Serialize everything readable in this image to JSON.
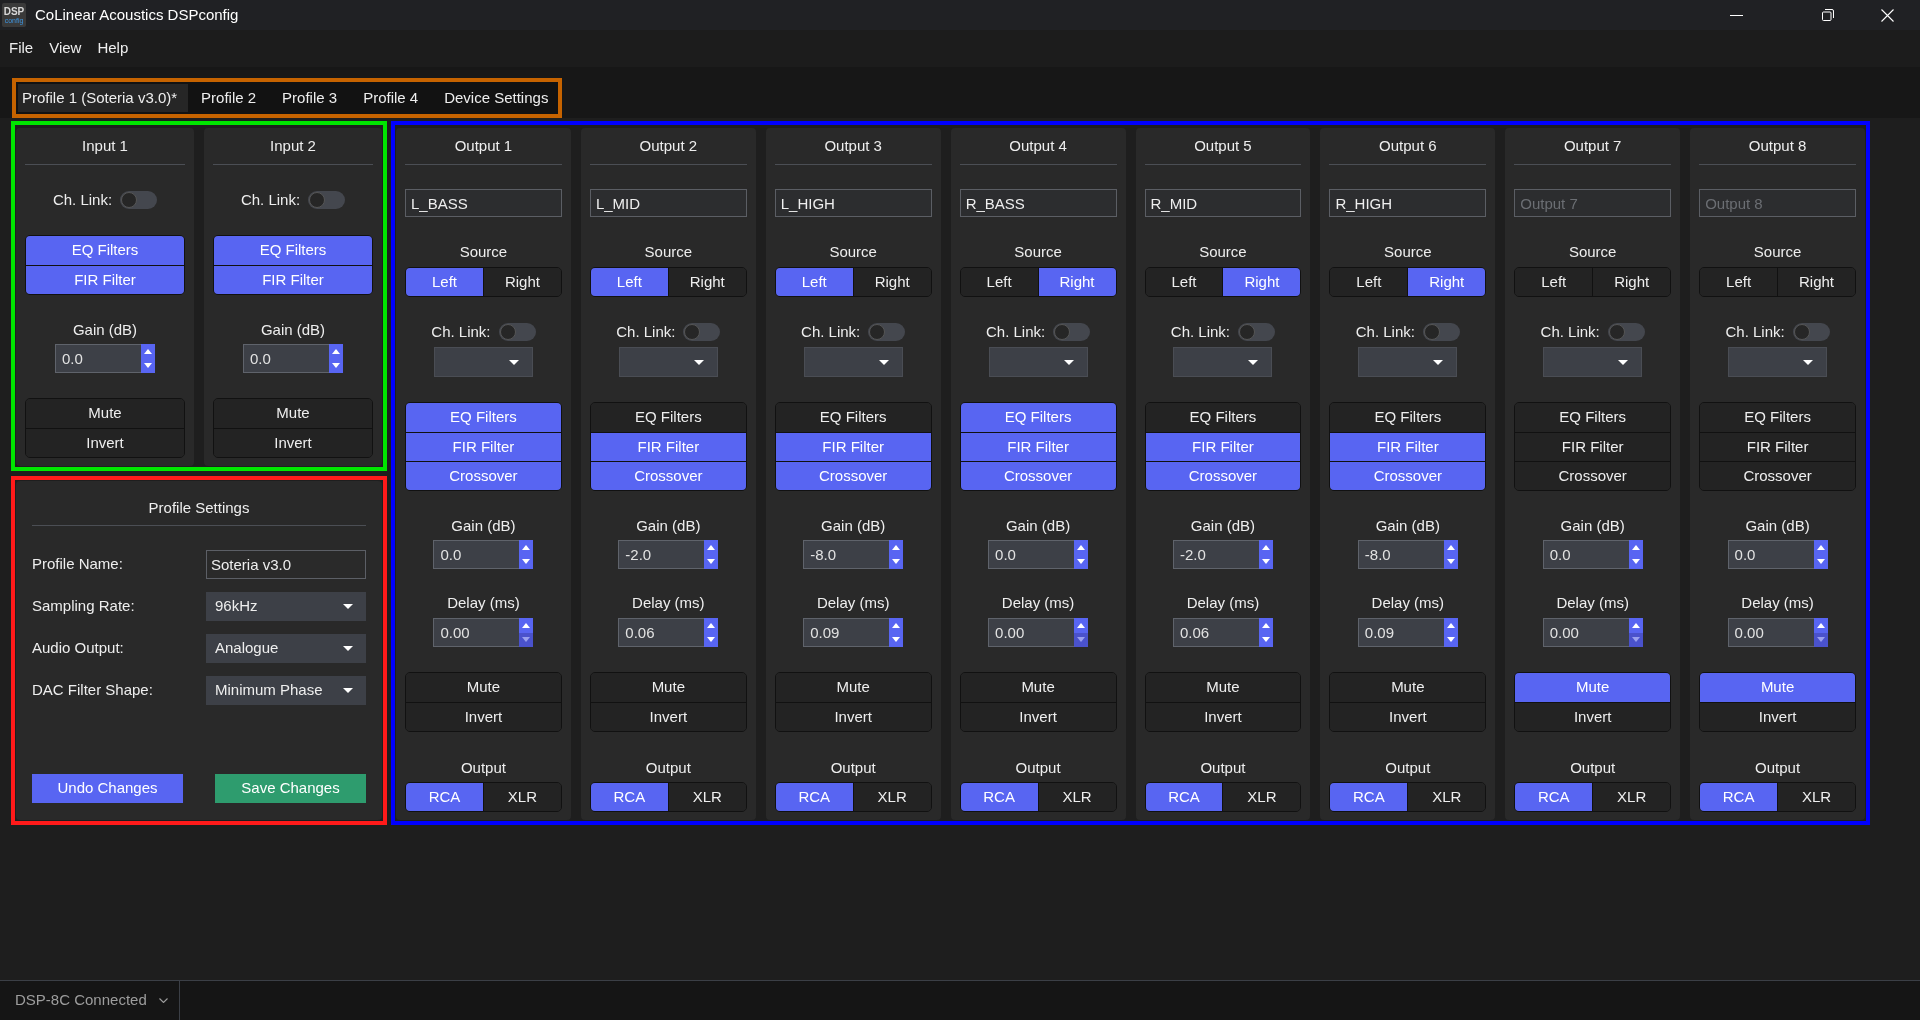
{
  "window": {
    "title": "CoLinear Acoustics DSPconfig",
    "logo_text": [
      "DSP",
      "config"
    ]
  },
  "menu": [
    "File",
    "View",
    "Help"
  ],
  "tabs": [
    {
      "label": "Profile 1 (Soteria v3.0)*",
      "selected": true
    },
    {
      "label": "Profile 2",
      "selected": false
    },
    {
      "label": "Profile 3",
      "selected": false
    },
    {
      "label": "Profile 4",
      "selected": false
    },
    {
      "label": "Device Settings",
      "selected": false
    }
  ],
  "inputs": [
    {
      "title": "Input 1",
      "ch_link": {
        "label": "Ch. Link:",
        "on": false
      },
      "processing": [
        {
          "label": "EQ Filters",
          "on": true
        },
        {
          "label": "FIR Filter",
          "on": true
        }
      ],
      "gain": {
        "label": "Gain (dB)",
        "value": "0.0"
      },
      "toggles": [
        {
          "label": "Mute",
          "on": false
        },
        {
          "label": "Invert",
          "on": false
        }
      ]
    },
    {
      "title": "Input 2",
      "ch_link": {
        "label": "Ch. Link:",
        "on": false
      },
      "processing": [
        {
          "label": "EQ Filters",
          "on": true
        },
        {
          "label": "FIR Filter",
          "on": true
        }
      ],
      "gain": {
        "label": "Gain (dB)",
        "value": "0.0"
      },
      "toggles": [
        {
          "label": "Mute",
          "on": false
        },
        {
          "label": "Invert",
          "on": false
        }
      ]
    }
  ],
  "profile_settings": {
    "title": "Profile Settings",
    "fields": [
      {
        "label": "Profile Name:",
        "kind": "text",
        "value": "Soteria v3.0"
      },
      {
        "label": "Sampling Rate:",
        "kind": "dropdown",
        "value": "96kHz"
      },
      {
        "label": "Audio Output:",
        "kind": "dropdown",
        "value": "Analogue"
      },
      {
        "label": "DAC Filter Shape:",
        "kind": "dropdown",
        "value": "Minimum Phase"
      }
    ],
    "buttons": [
      {
        "label": "Undo Changes",
        "kind": "undo"
      },
      {
        "label": "Save Changes",
        "kind": "save"
      }
    ]
  },
  "outputs": [
    {
      "title": "Output 1",
      "name": {
        "value": "L_BASS"
      },
      "source": {
        "label": "Source",
        "options": [
          {
            "label": "Left",
            "selected": true
          },
          {
            "label": "Right",
            "selected": false
          }
        ]
      },
      "ch_link": {
        "label": "Ch. Link:",
        "on": false
      },
      "processing": [
        {
          "label": "EQ Filters",
          "on": true
        },
        {
          "label": "FIR Filter",
          "on": true
        },
        {
          "label": "Crossover",
          "on": true
        }
      ],
      "gain": {
        "label": "Gain (dB)",
        "value": "0.0"
      },
      "delay": {
        "label": "Delay (ms)",
        "value": "0.00",
        "decrement_disabled": true
      },
      "toggles": [
        {
          "label": "Mute",
          "on": false
        },
        {
          "label": "Invert",
          "on": false
        }
      ],
      "output": {
        "label": "Output",
        "options": [
          {
            "label": "RCA",
            "selected": true
          },
          {
            "label": "XLR",
            "selected": false
          }
        ]
      }
    },
    {
      "title": "Output 2",
      "name": {
        "value": "L_MID"
      },
      "source": {
        "label": "Source",
        "options": [
          {
            "label": "Left",
            "selected": true
          },
          {
            "label": "Right",
            "selected": false
          }
        ]
      },
      "ch_link": {
        "label": "Ch. Link:",
        "on": false
      },
      "processing": [
        {
          "label": "EQ Filters",
          "on": false
        },
        {
          "label": "FIR Filter",
          "on": true
        },
        {
          "label": "Crossover",
          "on": true
        }
      ],
      "gain": {
        "label": "Gain (dB)",
        "value": "-2.0"
      },
      "delay": {
        "label": "Delay (ms)",
        "value": "0.06",
        "decrement_disabled": false
      },
      "toggles": [
        {
          "label": "Mute",
          "on": false
        },
        {
          "label": "Invert",
          "on": false
        }
      ],
      "output": {
        "label": "Output",
        "options": [
          {
            "label": "RCA",
            "selected": true
          },
          {
            "label": "XLR",
            "selected": false
          }
        ]
      }
    },
    {
      "title": "Output 3",
      "name": {
        "value": "L_HIGH"
      },
      "source": {
        "label": "Source",
        "options": [
          {
            "label": "Left",
            "selected": true
          },
          {
            "label": "Right",
            "selected": false
          }
        ]
      },
      "ch_link": {
        "label": "Ch. Link:",
        "on": false
      },
      "processing": [
        {
          "label": "EQ Filters",
          "on": false
        },
        {
          "label": "FIR Filter",
          "on": true
        },
        {
          "label": "Crossover",
          "on": true
        }
      ],
      "gain": {
        "label": "Gain (dB)",
        "value": "-8.0"
      },
      "delay": {
        "label": "Delay (ms)",
        "value": "0.09",
        "decrement_disabled": false
      },
      "toggles": [
        {
          "label": "Mute",
          "on": false
        },
        {
          "label": "Invert",
          "on": false
        }
      ],
      "output": {
        "label": "Output",
        "options": [
          {
            "label": "RCA",
            "selected": true
          },
          {
            "label": "XLR",
            "selected": false
          }
        ]
      }
    },
    {
      "title": "Output 4",
      "name": {
        "value": "R_BASS"
      },
      "source": {
        "label": "Source",
        "options": [
          {
            "label": "Left",
            "selected": false
          },
          {
            "label": "Right",
            "selected": true
          }
        ]
      },
      "ch_link": {
        "label": "Ch. Link:",
        "on": false
      },
      "processing": [
        {
          "label": "EQ Filters",
          "on": true
        },
        {
          "label": "FIR Filter",
          "on": true
        },
        {
          "label": "Crossover",
          "on": true
        }
      ],
      "gain": {
        "label": "Gain (dB)",
        "value": "0.0"
      },
      "delay": {
        "label": "Delay (ms)",
        "value": "0.00",
        "decrement_disabled": true
      },
      "toggles": [
        {
          "label": "Mute",
          "on": false
        },
        {
          "label": "Invert",
          "on": false
        }
      ],
      "output": {
        "label": "Output",
        "options": [
          {
            "label": "RCA",
            "selected": true
          },
          {
            "label": "XLR",
            "selected": false
          }
        ]
      }
    },
    {
      "title": "Output 5",
      "name": {
        "value": "R_MID"
      },
      "source": {
        "label": "Source",
        "options": [
          {
            "label": "Left",
            "selected": false
          },
          {
            "label": "Right",
            "selected": true
          }
        ]
      },
      "ch_link": {
        "label": "Ch. Link:",
        "on": false
      },
      "processing": [
        {
          "label": "EQ Filters",
          "on": false
        },
        {
          "label": "FIR Filter",
          "on": true
        },
        {
          "label": "Crossover",
          "on": true
        }
      ],
      "gain": {
        "label": "Gain (dB)",
        "value": "-2.0"
      },
      "delay": {
        "label": "Delay (ms)",
        "value": "0.06",
        "decrement_disabled": false
      },
      "toggles": [
        {
          "label": "Mute",
          "on": false
        },
        {
          "label": "Invert",
          "on": false
        }
      ],
      "output": {
        "label": "Output",
        "options": [
          {
            "label": "RCA",
            "selected": true
          },
          {
            "label": "XLR",
            "selected": false
          }
        ]
      }
    },
    {
      "title": "Output 6",
      "name": {
        "value": "R_HIGH"
      },
      "source": {
        "label": "Source",
        "options": [
          {
            "label": "Left",
            "selected": false
          },
          {
            "label": "Right",
            "selected": true
          }
        ]
      },
      "ch_link": {
        "label": "Ch. Link:",
        "on": false
      },
      "processing": [
        {
          "label": "EQ Filters",
          "on": false
        },
        {
          "label": "FIR Filter",
          "on": true
        },
        {
          "label": "Crossover",
          "on": true
        }
      ],
      "gain": {
        "label": "Gain (dB)",
        "value": "-8.0"
      },
      "delay": {
        "label": "Delay (ms)",
        "value": "0.09",
        "decrement_disabled": false
      },
      "toggles": [
        {
          "label": "Mute",
          "on": false
        },
        {
          "label": "Invert",
          "on": false
        }
      ],
      "output": {
        "label": "Output",
        "options": [
          {
            "label": "RCA",
            "selected": true
          },
          {
            "label": "XLR",
            "selected": false
          }
        ]
      }
    },
    {
      "title": "Output 7",
      "name": {
        "placeholder": "Output 7"
      },
      "source": {
        "label": "Source",
        "options": [
          {
            "label": "Left",
            "selected": false
          },
          {
            "label": "Right",
            "selected": false
          }
        ]
      },
      "ch_link": {
        "label": "Ch. Link:",
        "on": false
      },
      "processing": [
        {
          "label": "EQ Filters",
          "on": false
        },
        {
          "label": "FIR Filter",
          "on": false
        },
        {
          "label": "Crossover",
          "on": false
        }
      ],
      "gain": {
        "label": "Gain (dB)",
        "value": "0.0"
      },
      "delay": {
        "label": "Delay (ms)",
        "value": "0.00",
        "decrement_disabled": true
      },
      "toggles": [
        {
          "label": "Mute",
          "on": true
        },
        {
          "label": "Invert",
          "on": false
        }
      ],
      "output": {
        "label": "Output",
        "options": [
          {
            "label": "RCA",
            "selected": true
          },
          {
            "label": "XLR",
            "selected": false
          }
        ]
      }
    },
    {
      "title": "Output 8",
      "name": {
        "placeholder": "Output 8"
      },
      "source": {
        "label": "Source",
        "options": [
          {
            "label": "Left",
            "selected": false
          },
          {
            "label": "Right",
            "selected": false
          }
        ]
      },
      "ch_link": {
        "label": "Ch. Link:",
        "on": false
      },
      "processing": [
        {
          "label": "EQ Filters",
          "on": false
        },
        {
          "label": "FIR Filter",
          "on": false
        },
        {
          "label": "Crossover",
          "on": false
        }
      ],
      "gain": {
        "label": "Gain (dB)",
        "value": "0.0"
      },
      "delay": {
        "label": "Delay (ms)",
        "value": "0.00",
        "decrement_disabled": true
      },
      "toggles": [
        {
          "label": "Mute",
          "on": true
        },
        {
          "label": "Invert",
          "on": false
        }
      ],
      "output": {
        "label": "Output",
        "options": [
          {
            "label": "RCA",
            "selected": true
          },
          {
            "label": "XLR",
            "selected": false
          }
        ]
      }
    }
  ],
  "status_bar": {
    "device": "DSP-8C Connected"
  }
}
